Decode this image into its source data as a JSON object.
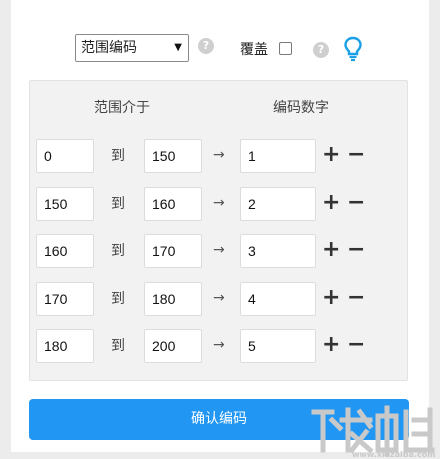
{
  "encode_mode": {
    "selected": "范围编码",
    "overwrite_label": "覆盖",
    "help_glyph": "?"
  },
  "range_table": {
    "header_range": "范围介于",
    "header_code": "编码数字",
    "to_label": "到",
    "arrow_glyph": "→",
    "plus_glyph": "+",
    "minus_glyph": "−",
    "rows": [
      {
        "from": "0",
        "to": "150",
        "code": "1"
      },
      {
        "from": "150",
        "to": "160",
        "code": "2"
      },
      {
        "from": "160",
        "to": "170",
        "code": "3"
      },
      {
        "from": "170",
        "to": "180",
        "code": "4"
      },
      {
        "from": "180",
        "to": "200",
        "code": "5"
      }
    ]
  },
  "confirm_label": "确认编码",
  "colors": {
    "accent": "#2196f3",
    "bulb": "#1aa0e6"
  },
  "icons": {
    "select_arrow": "chevron-down-icon",
    "help": "help-icon",
    "bulb": "lightbulb-icon"
  }
}
